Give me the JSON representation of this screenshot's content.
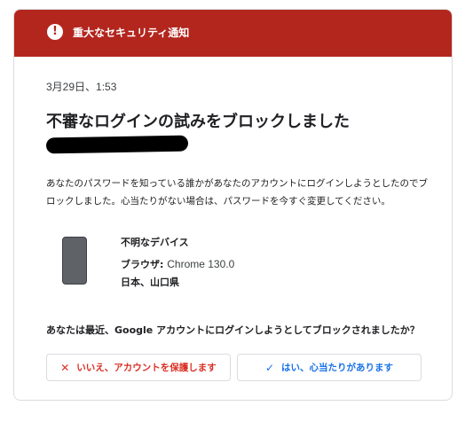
{
  "banner": {
    "icon": "alert-icon",
    "title": "重大なセキュリティ通知",
    "color": "#b3261e"
  },
  "notice": {
    "date": "3月29日、1:53",
    "heading": "不審なログインの試みをブロックしました",
    "description": "あなたのパスワードを知っている誰かがあなたのアカウントにログインしようとしたのでブロックしました。心当たりがない場合は、パスワードを今すぐ変更してください。"
  },
  "device": {
    "icon": "phone-icon",
    "name": "不明なデバイス",
    "browser_label": "ブラウザ: ",
    "browser_value": "Chrome 130.0",
    "location": "日本、山口県"
  },
  "question": "あなたは最近、Google アカウントにログインしようとしてブロックされましたか？",
  "actions": {
    "no": {
      "icon": "x-icon",
      "label": "いいえ、アカウントを保護します",
      "color": "#d93025"
    },
    "yes": {
      "icon": "check-icon",
      "label": "はい、心当たりがあります",
      "color": "#1a73e8"
    }
  }
}
